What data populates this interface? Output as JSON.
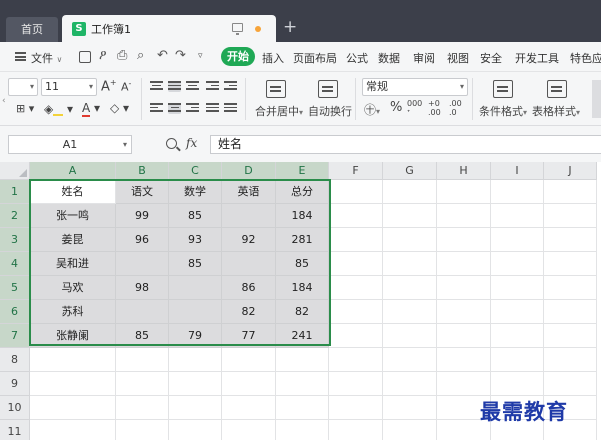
{
  "tabs": {
    "home": "首页",
    "document": "工作簿1",
    "doc_badge": "S"
  },
  "menu": {
    "file": "文件",
    "start": "开始",
    "items": [
      "插入",
      "页面布局",
      "公式",
      "数据",
      "审阅",
      "视图",
      "安全",
      "开发工具",
      "特色应"
    ]
  },
  "ribbon": {
    "font_size": "11",
    "increase_font": "A",
    "decrease_font": "A",
    "number_format": "常规",
    "percent": "%",
    "thousands": "000",
    "merge_center": "合并居中",
    "wrap_text": "自动换行",
    "conditional_format": "条件格式",
    "table_style": "表格样式",
    "increase_decimal": ".00",
    "decrease_decimal": ".0"
  },
  "formula_bar": {
    "name_box": "A1",
    "fx_label": "fx",
    "content": "姓名"
  },
  "sheet": {
    "columns": [
      "A",
      "B",
      "C",
      "D",
      "E",
      "F",
      "G",
      "H",
      "I",
      "J"
    ],
    "rows": [
      "1",
      "2",
      "3",
      "4",
      "5",
      "6",
      "7",
      "8",
      "9",
      "10",
      "11"
    ],
    "data": [
      [
        "姓名",
        "语文",
        "数学",
        "英语",
        "总分"
      ],
      [
        "张一鸣",
        "99",
        "85",
        "",
        "184"
      ],
      [
        "姜昆",
        "96",
        "93",
        "92",
        "281"
      ],
      [
        "吴和进",
        "",
        "85",
        "",
        "85"
      ],
      [
        "马欢",
        "98",
        "",
        "86",
        "184"
      ],
      [
        "苏科",
        "",
        "",
        "82",
        "82"
      ],
      [
        "张静阑",
        "85",
        "79",
        "77",
        "241"
      ]
    ]
  },
  "watermark": "最需教育",
  "colors": {
    "accent_green": "#1fa855",
    "selection_border": "#2a8c4a",
    "title_bar": "#3c3f4a",
    "watermark": "#1f3aa8"
  },
  "icons": {
    "save": "save-icon",
    "print": "print-icon",
    "undo": "undo-icon",
    "redo": "redo-icon",
    "zoom": "zoom-icon"
  }
}
